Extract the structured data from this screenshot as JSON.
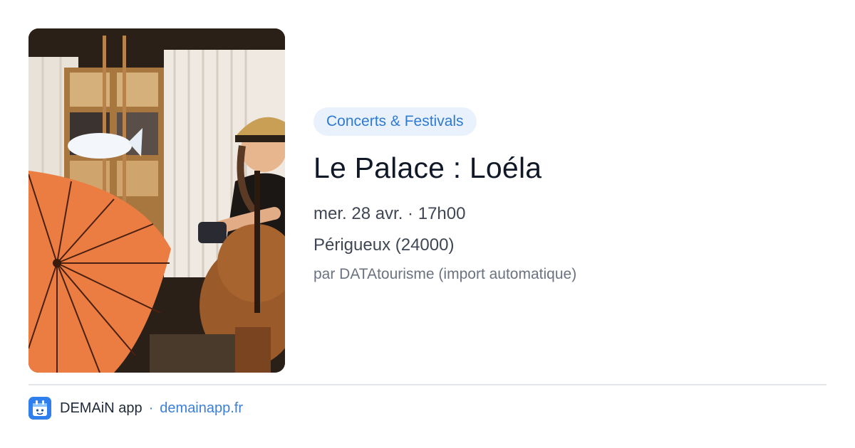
{
  "event": {
    "category": "Concerts & Festivals",
    "title": "Le Palace : Loéla",
    "datetime": "mer. 28 avr. · 17h00",
    "location": "Périgueux (24000)",
    "source": "par DATAtourisme (import automatique)"
  },
  "footer": {
    "app_name": "DEMAiN app",
    "separator": "·",
    "link": "demainapp.fr",
    "logo_icon": "demain-app-logo-icon"
  },
  "colors": {
    "chip_bg": "#e9f2fc",
    "chip_text": "#2f7ad1",
    "link": "#3b7fd6",
    "logo_bg": "#2f80ed",
    "umbrella": "#e8743a"
  }
}
